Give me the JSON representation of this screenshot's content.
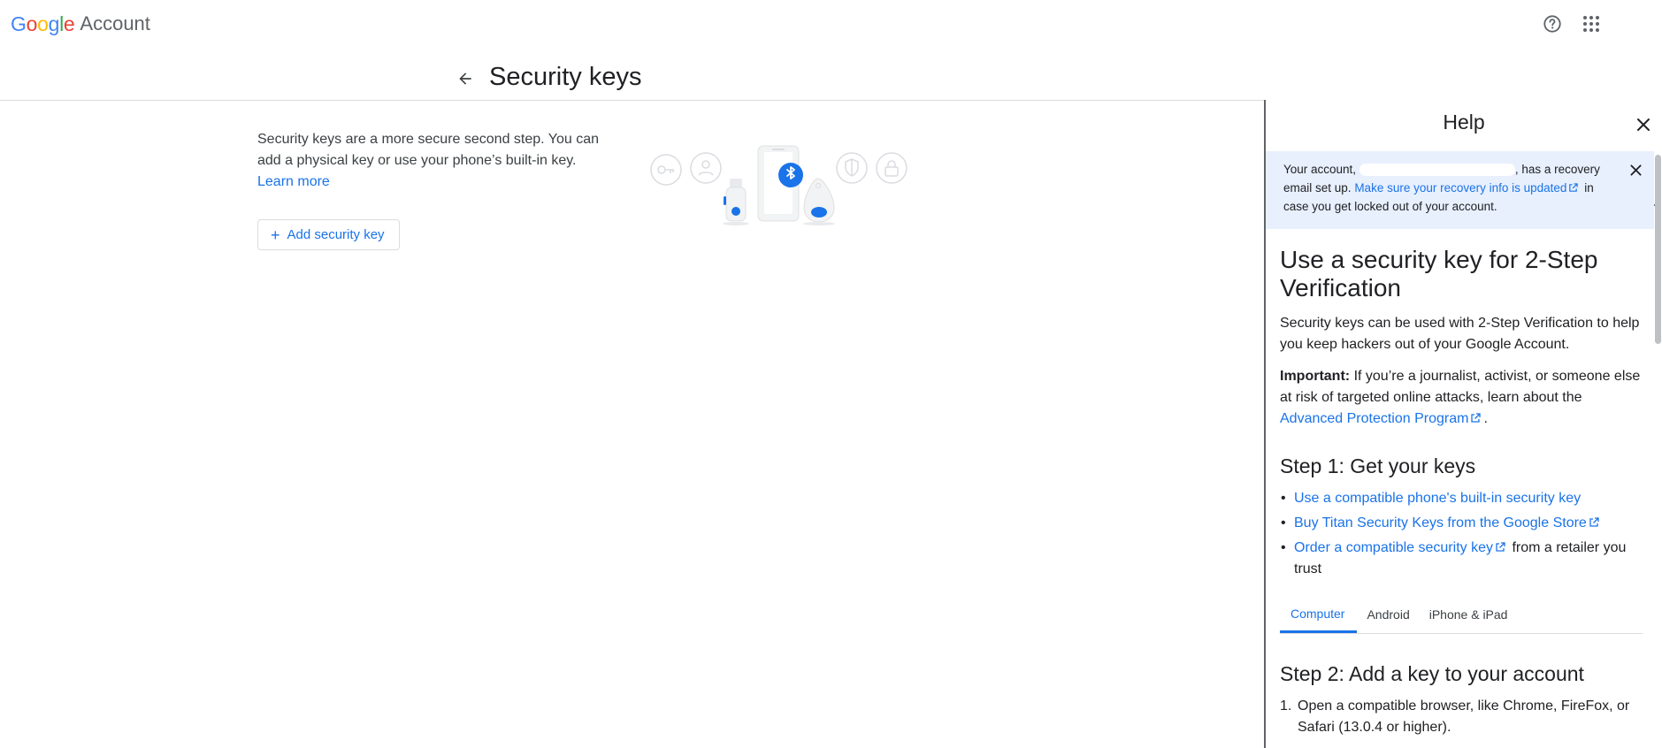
{
  "header": {
    "logo_google": "Google",
    "logo_account": "Account",
    "help_icon": "help-circle-icon",
    "apps_icon": "apps-grid-icon"
  },
  "page": {
    "title": "Security keys",
    "back_icon": "arrow-back-icon"
  },
  "main": {
    "description": "Security keys are a more secure second step. You can add a physical key or use your phone’s built-in key.",
    "learn_more": "Learn more",
    "add_button": "Add security key"
  },
  "help": {
    "title": "Help",
    "banner": {
      "prefix": "Your account,",
      "suffix": ", has a recovery email set up.",
      "link": "Make sure your recovery info is updated",
      "tail": "in case you get locked out of your account."
    },
    "heading": "Use a security key for 2-Step Verification",
    "intro": "Security keys can be used with 2-Step Verification to help you keep hackers out of your Google Account.",
    "important_label": "Important:",
    "important_text": "If you’re a journalist, activist, or someone else at risk of targeted online attacks, learn about the",
    "important_link": "Advanced Protection Program",
    "important_end": ".",
    "step1": "Step 1: Get your keys",
    "step1_items": [
      {
        "link": "Use a compatible phone's built-in security key",
        "tail": ""
      },
      {
        "link": "Buy Titan Security Keys from the Google Store",
        "tail": ""
      },
      {
        "link": "Order a compatible security key",
        "tail": "from a retailer you trust"
      }
    ],
    "tabs": [
      "Computer",
      "Android",
      "iPhone & iPad"
    ],
    "active_tab": "Computer",
    "step2": "Step 2: Add a key to your account",
    "step2_items": [
      {
        "num": "1.",
        "text": "Open a compatible browser, like Chrome, FireFox, or Safari (13.0.4 or higher)."
      }
    ]
  },
  "colors": {
    "accent": "#1a73e8",
    "banner_bg": "#e8f0fe",
    "divider": "#dadce0"
  }
}
